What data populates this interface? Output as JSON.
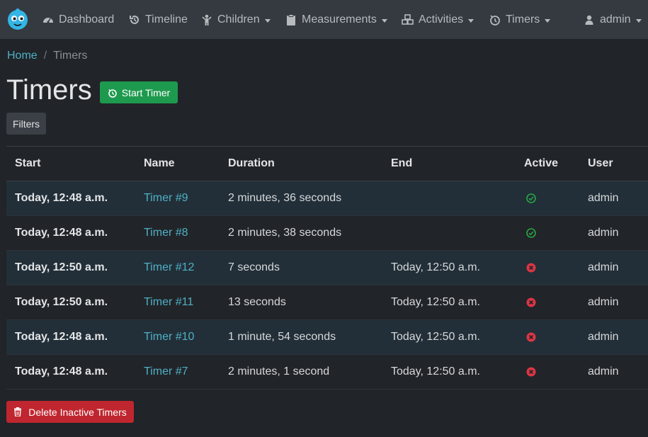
{
  "nav": {
    "items": [
      {
        "label": "Dashboard",
        "icon": "dashboard-icon",
        "dropdown": false
      },
      {
        "label": "Timeline",
        "icon": "history-icon",
        "dropdown": false
      },
      {
        "label": "Children",
        "icon": "child-icon",
        "dropdown": true
      },
      {
        "label": "Measurements",
        "icon": "clipboard-icon",
        "dropdown": true
      },
      {
        "label": "Activities",
        "icon": "cubes-icon",
        "dropdown": true
      },
      {
        "label": "Timers",
        "icon": "timer-icon",
        "dropdown": true
      }
    ],
    "user": {
      "label": "admin",
      "icon": "user-icon"
    }
  },
  "breadcrumb": {
    "home": "Home",
    "separator": "/",
    "current": "Timers"
  },
  "page": {
    "title": "Timers",
    "start_timer_label": "Start Timer",
    "filters_label": "Filters"
  },
  "table": {
    "headers": [
      "Start",
      "Name",
      "Duration",
      "End",
      "Active",
      "User"
    ],
    "rows": [
      {
        "start": "Today, 12:48 a.m.",
        "name": "Timer #9",
        "duration": "2 minutes, 36 seconds",
        "end": "",
        "active": true,
        "user": "admin"
      },
      {
        "start": "Today, 12:48 a.m.",
        "name": "Timer #8",
        "duration": "2 minutes, 38 seconds",
        "end": "",
        "active": true,
        "user": "admin"
      },
      {
        "start": "Today, 12:50 a.m.",
        "name": "Timer #12",
        "duration": "7 seconds",
        "end": "Today, 12:50 a.m.",
        "active": false,
        "user": "admin"
      },
      {
        "start": "Today, 12:50 a.m.",
        "name": "Timer #11",
        "duration": "13 seconds",
        "end": "Today, 12:50 a.m.",
        "active": false,
        "user": "admin"
      },
      {
        "start": "Today, 12:48 a.m.",
        "name": "Timer #10",
        "duration": "1 minute, 54 seconds",
        "end": "Today, 12:50 a.m.",
        "active": false,
        "user": "admin"
      },
      {
        "start": "Today, 12:48 a.m.",
        "name": "Timer #7",
        "duration": "2 minutes, 1 second",
        "end": "Today, 12:50 a.m.",
        "active": false,
        "user": "admin"
      }
    ]
  },
  "actions": {
    "delete_inactive_label": "Delete Inactive Timers"
  },
  "colors": {
    "navbar": "#343a40",
    "background": "#212428",
    "link": "#4fb0c6",
    "success": "#1e9a4e",
    "danger": "#c0262f",
    "active_check": "#28a745",
    "inactive_x": "#dc3545"
  }
}
